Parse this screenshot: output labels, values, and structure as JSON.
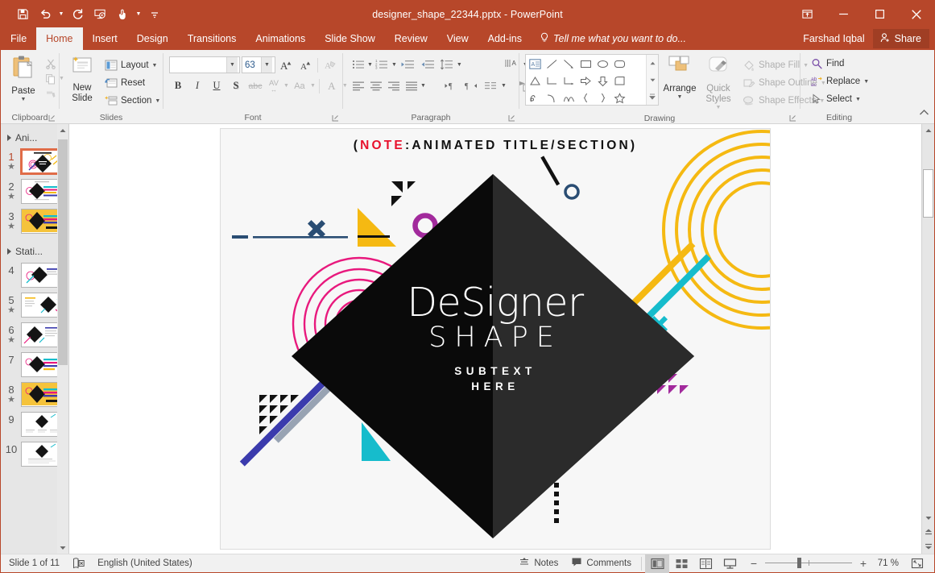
{
  "title_bar": {
    "document_title": "designer_shape_22344.pptx - PowerPoint",
    "qat": [
      {
        "name": "save",
        "icon": "save-icon"
      },
      {
        "name": "undo",
        "icon": "undo-icon"
      },
      {
        "name": "redo",
        "icon": "redo-icon"
      },
      {
        "name": "start-from-beginning",
        "icon": "presentation-icon"
      },
      {
        "name": "touch-mouse-mode",
        "icon": "touch-icon"
      },
      {
        "name": "customize-qat",
        "icon": "chevron-down-icon"
      }
    ],
    "window_controls": {
      "ribbon_display_options": "ribbon-options-icon",
      "minimize": "minimize-icon",
      "restore": "restore-icon",
      "close": "close-icon"
    }
  },
  "tabs": {
    "file": "File",
    "items": [
      "Home",
      "Insert",
      "Design",
      "Transitions",
      "Animations",
      "Slide Show",
      "Review",
      "View",
      "Add-ins"
    ],
    "active": "Home",
    "tell_me": "Tell me what you want to do...",
    "user_name": "Farshad Iqbal",
    "share_label": "Share"
  },
  "ribbon": {
    "groups": [
      {
        "name": "clipboard",
        "label": "Clipboard",
        "paste_label": "Paste",
        "buttons": [
          "Cut",
          "Copy",
          "Format Painter"
        ]
      },
      {
        "name": "slides",
        "label": "Slides",
        "new_slide_label": "New Slide",
        "layout_label": "Layout",
        "reset_label": "Reset",
        "section_label": "Section"
      },
      {
        "name": "font",
        "label": "Font",
        "font_name_value": "",
        "font_name_placeholder": "",
        "font_size_value": "63",
        "buttons": [
          "Increase Font Size",
          "Decrease Font Size",
          "Clear All Formatting",
          "Bold",
          "Italic",
          "Underline",
          "Text Shadow",
          "Strikethrough",
          "Character Spacing",
          "Change Case",
          "Font Color"
        ],
        "bold": "B",
        "italic": "I",
        "underline": "U",
        "shadow": "S",
        "strike": "abc",
        "spacing": "AV",
        "case": "Aa",
        "color": "A"
      },
      {
        "name": "paragraph",
        "label": "Paragraph",
        "buttons": [
          "Bullets",
          "Numbering",
          "Decrease List Level",
          "Increase List Level",
          "Line Spacing",
          "Text Direction",
          "Align Text",
          "Convert to SmartArt",
          "Align Left",
          "Center",
          "Align Right",
          "Justify",
          "Columns"
        ]
      },
      {
        "name": "drawing",
        "label": "Drawing",
        "arrange_label": "Arrange",
        "quick_styles_label": "Quick Styles",
        "shape_fill_label": "Shape Fill",
        "shape_outline_label": "Shape Outline",
        "shape_effects_label": "Shape Effects"
      },
      {
        "name": "editing",
        "label": "Editing",
        "find_label": "Find",
        "replace_label": "Replace",
        "select_label": "Select"
      }
    ]
  },
  "slide_panel": {
    "sections": [
      {
        "label": "Ani...",
        "expanded": true
      },
      {
        "label": "Stati...",
        "expanded": true
      }
    ],
    "slides": [
      {
        "number": "1",
        "animated": true,
        "selected": true,
        "style": "white-a",
        "section": 0
      },
      {
        "number": "2",
        "animated": true,
        "selected": false,
        "style": "white-b",
        "section": 0
      },
      {
        "number": "3",
        "animated": true,
        "selected": false,
        "style": "yellow",
        "section": 0
      },
      {
        "number": "4",
        "animated": false,
        "selected": false,
        "style": "white-a",
        "section": 1
      },
      {
        "number": "5",
        "animated": true,
        "selected": false,
        "style": "white-c",
        "section": 1
      },
      {
        "number": "6",
        "animated": true,
        "selected": false,
        "style": "white-c",
        "section": 1
      },
      {
        "number": "7",
        "animated": false,
        "selected": false,
        "style": "white-b",
        "section": 1
      },
      {
        "number": "8",
        "animated": true,
        "selected": false,
        "style": "yellow",
        "section": 1
      },
      {
        "number": "9",
        "animated": false,
        "selected": false,
        "style": "white-d",
        "section": 1
      },
      {
        "number": "10",
        "animated": false,
        "selected": false,
        "style": "white-d",
        "section": 1
      }
    ]
  },
  "slide": {
    "note_open_paren": "(",
    "note_red": "NOTE",
    "note_rest": ":ANIMATED TITLE/SECTION)",
    "headline": "DeSigner",
    "subhead": "SHAPE",
    "subtext_line1": "SUBTEXT",
    "subtext_line2": "HERE",
    "colors": {
      "diamond_left": "#0a0a0a",
      "diamond_right": "#2b2b2b",
      "pink": "#e8197d",
      "magenta": "#a02090",
      "yellow": "#f5b912",
      "teal": "#16bccc",
      "navy": "#2a4d73",
      "indigo": "#3b3bad",
      "gray_blue": "#98a3b3",
      "purple_ring": "#a22a9c",
      "canvas_bg": "#f7f7f7"
    }
  },
  "status_bar": {
    "slide_indicator": "Slide 1 of 11",
    "language": "English (United States)",
    "notes_label": "Notes",
    "comments_label": "Comments",
    "views": [
      "Normal",
      "Slide Sorter",
      "Reading View",
      "Slide Show"
    ],
    "active_view": "Normal",
    "zoom_minus": "−",
    "zoom_plus": "+",
    "zoom_level": "71 %",
    "fit_slide_icon": "fit-to-window-icon"
  }
}
